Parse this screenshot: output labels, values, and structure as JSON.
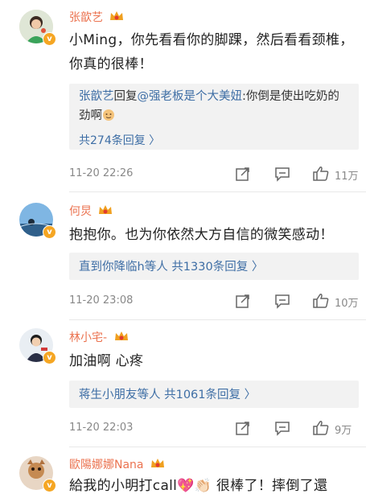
{
  "comments": [
    {
      "name": "张歆艺",
      "text": "小Ming，你先看看你的脚踝，然后看看颈椎，你真的很棒！",
      "reply": {
        "author": "张歆艺",
        "verb": "回复",
        "mention": "@强老板是个大美妞",
        "body": ":你倒是使出吃奶的劲啊",
        "more": "共274条回复 〉"
      },
      "time": "11-20 22:26",
      "likes": "11万"
    },
    {
      "name": "何炅",
      "text": "抱抱你。也为你依然大方自信的微笑感动！",
      "reply_summary": {
        "names": "直到你降临h等人",
        "count": "共1330条回复 〉"
      },
      "time": "11-20 23:08",
      "likes": "10万"
    },
    {
      "name": "林小宅-",
      "text": "加油啊 心疼",
      "reply_summary": {
        "names": "蒋生小朋友等人",
        "count": "共1061条回复 〉"
      },
      "time": "11-20 22:03",
      "likes": "9万"
    },
    {
      "name": "歐陽娜娜Nana",
      "text": "給我的小明打call💖👏🏻 很棒了！摔倒了還"
    }
  ],
  "icons": {
    "verified": "verified-badge-icon",
    "crown": "crown-icon",
    "share": "share-icon",
    "comment": "comment-icon",
    "like": "thumbs-up-icon"
  },
  "colors": {
    "name": "#eb7350",
    "link": "#3e6ea5",
    "badge": "#f5a623",
    "meta": "#888888"
  }
}
